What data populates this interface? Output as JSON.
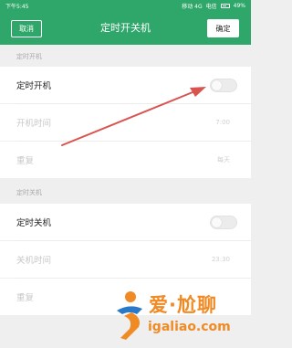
{
  "status_bar": {
    "time": "下午5:45",
    "carrier": "移动 4G",
    "carrier2": "电信",
    "battery": "49%"
  },
  "header": {
    "cancel_label": "取消",
    "title": "定时开关机",
    "confirm_label": "确定"
  },
  "power_on": {
    "section_label": "定时开机",
    "toggle_label": "定时开机",
    "toggle_on": false,
    "time_label": "开机时间",
    "time_value": "7:00",
    "repeat_label": "重复",
    "repeat_value": "每天"
  },
  "power_off": {
    "section_label": "定时关机",
    "toggle_label": "定时关机",
    "toggle_on": false,
    "time_label": "关机时间",
    "time_value": "23:30",
    "repeat_label": "重复"
  },
  "watermark": {
    "brand": "爱·尬聊",
    "domain": "igaliao.com"
  },
  "colors": {
    "primary": "#2fa76a",
    "arrow": "#d9534f",
    "watermark": "#f08a24"
  }
}
